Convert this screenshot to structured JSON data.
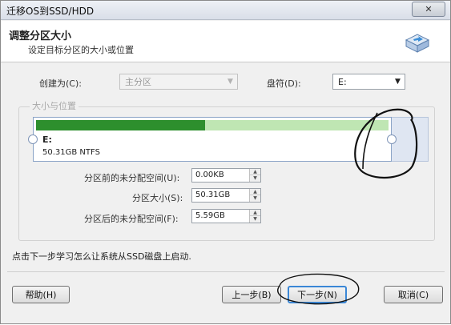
{
  "window": {
    "title": "迁移OS到SSD/HDD",
    "close_symbol": "✕"
  },
  "header": {
    "title": "调整分区大小",
    "subtitle": "设定目标分区的大小或位置"
  },
  "form": {
    "create_as_label": "创建为(C):",
    "create_as_value": "主分区",
    "drive_letter_label": "盘符(D):",
    "drive_letter_value": "E:",
    "dropdown_symbol": "▼"
  },
  "size_position": {
    "legend": "大小与位置",
    "partition_letter": "E:",
    "partition_info": "50.31GB NTFS",
    "used_fraction": 0.48,
    "before_label": "分区前的未分配空间(U):",
    "before_value": "0.00KB",
    "size_label": "分区大小(S):",
    "size_value": "50.31GB",
    "after_label": "分区后的未分配空间(F):",
    "after_value": "5.59GB",
    "spin_up": "▲",
    "spin_down": "▼"
  },
  "hint": "点击下一步学习怎么让系统从SSD磁盘上启动.",
  "buttons": {
    "help": "帮助(H)",
    "back": "上一步(B)",
    "next": "下一步(N)",
    "cancel": "取消(C)"
  },
  "colors": {
    "used": "#2d8f2d",
    "free": "#bfe6b3",
    "unallocated": "#dfe6f2",
    "primary_button_border": "#3a87d6"
  }
}
